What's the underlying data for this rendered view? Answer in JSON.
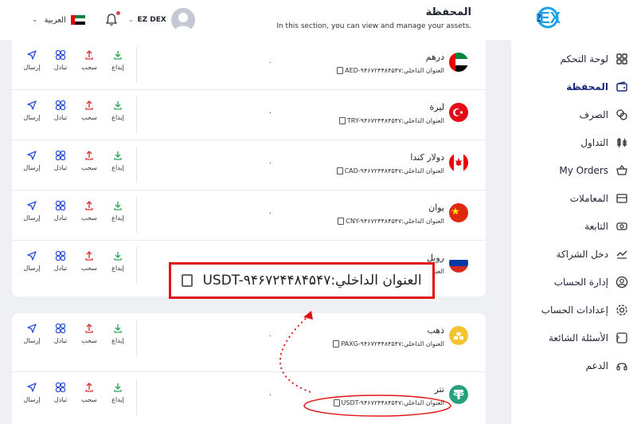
{
  "app": {
    "brand": "EZ DEX",
    "language": "العربية"
  },
  "header": {
    "title": "المحفظة",
    "subtitle": "In this section, you can view and manage your assets.",
    "user_name": "EZ DEX"
  },
  "sidebar": {
    "items": [
      {
        "label": "لوحة التحكم",
        "icon": "dashboard-icon"
      },
      {
        "label": "المحفظة",
        "icon": "wallet-icon",
        "active": true
      },
      {
        "label": "الصرف",
        "icon": "exchange-icon"
      },
      {
        "label": "التداول",
        "icon": "trade-icon"
      },
      {
        "label": "My Orders",
        "icon": "orders-icon"
      },
      {
        "label": "المعاملات",
        "icon": "transactions-icon"
      },
      {
        "label": "التابعة",
        "icon": "affiliate-icon"
      },
      {
        "label": "دخل الشراكة",
        "icon": "partnership-income-icon"
      },
      {
        "label": "إدارة الحساب",
        "icon": "account-management-icon"
      },
      {
        "label": "إعدادات الحساب",
        "icon": "settings-icon"
      },
      {
        "label": "الأسئلة الشائعة",
        "icon": "faq-icon"
      },
      {
        "label": "الدعم",
        "icon": "support-icon"
      }
    ]
  },
  "actions": {
    "deposit": "إيداع",
    "withdraw": "سحب",
    "swap": "تبادل",
    "send": "إرسال"
  },
  "fiat_wallets": [
    {
      "name": "درهم",
      "address": "العنوان الداخلي:AED-۹۴۶۷۲۴۴۸۴۵۴۷",
      "balance": "۰",
      "icon": "uae-flag-icon"
    },
    {
      "name": "ليرة",
      "address": "العنوان الداخلي:TRY-۹۴۶۷۲۴۴۸۴۵۴۷",
      "balance": "۰",
      "icon": "turkey-flag-icon"
    },
    {
      "name": "دولار كندا",
      "address": "العنوان الداخلي:CAD-۹۴۶۷۲۴۴۸۴۵۴۷",
      "balance": "۰",
      "icon": "canada-flag-icon"
    },
    {
      "name": "يوان",
      "address": "العنوان الداخلي:CNY-۹۴۶۷۲۴۴۸۴۵۴۷",
      "balance": "۰",
      "icon": "china-flag-icon"
    },
    {
      "name": "روبل",
      "address": "العنوان الداخلي:RUB-۹۴۶۷۲۴۴۸۴۵۴۷",
      "balance": "۰",
      "icon": "russia-flag-icon"
    }
  ],
  "crypto_wallets": [
    {
      "name": "ذهب",
      "address": "العنوان الداخلي:PAXG-۹۴۶۷۲۴۴۸۴۵۴۷",
      "balance": "۰",
      "icon": "gold-icon"
    },
    {
      "name": "تتر",
      "address": "العنوان الداخلي:USDT-۹۴۶۷۲۴۴۸۴۵۴۷",
      "balance": "۰",
      "icon": "tether-icon"
    }
  ],
  "zoom_callout": {
    "text": "العنوان الداخلي:USDT-۹۴۶۷۲۴۴۸۴۵۴۷"
  },
  "colors": {
    "deposit": "#2fa85a",
    "withdraw": "#e0302f",
    "swap": "#2b4fd8",
    "send": "#2b4fd8",
    "highlight": "#e01515",
    "active_nav": "#1b2a7a"
  }
}
